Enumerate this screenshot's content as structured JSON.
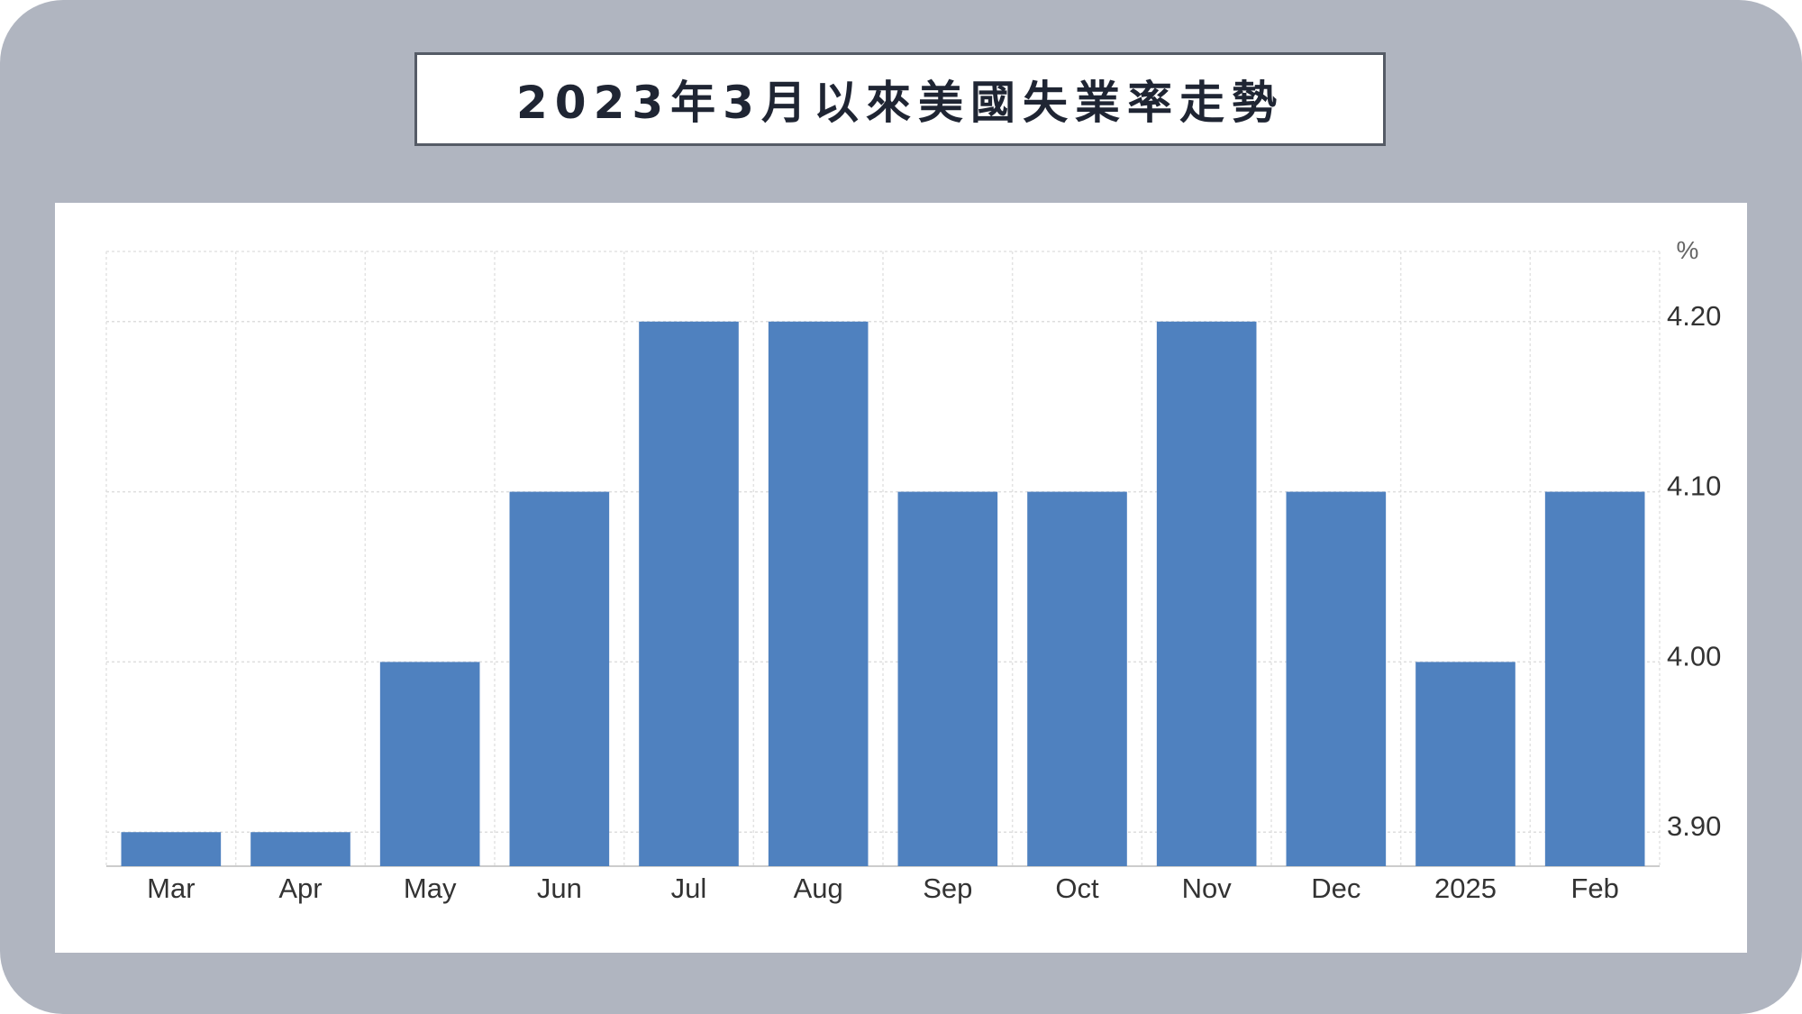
{
  "title": "2023年3月以來美國失業率走勢",
  "chart_data": {
    "type": "bar",
    "title": "2023年3月以來美國失業率走勢",
    "ylabel": "%",
    "categories": [
      "Mar",
      "Apr",
      "May",
      "Jun",
      "Jul",
      "Aug",
      "Sep",
      "Oct",
      "Nov",
      "Dec",
      "2025",
      "Feb"
    ],
    "values": [
      3.9,
      3.9,
      4.0,
      4.1,
      4.2,
      4.2,
      4.1,
      4.1,
      4.2,
      4.1,
      4.0,
      4.1
    ],
    "ylim": [
      3.88,
      4.22
    ],
    "yticks": [
      3.9,
      4.0,
      4.1,
      4.2
    ],
    "ytick_labels": [
      "3.90",
      "4.00",
      "4.10",
      "4.20"
    ],
    "y_axis_position": "right",
    "grid": true,
    "bar_color": "#4f81bf"
  }
}
